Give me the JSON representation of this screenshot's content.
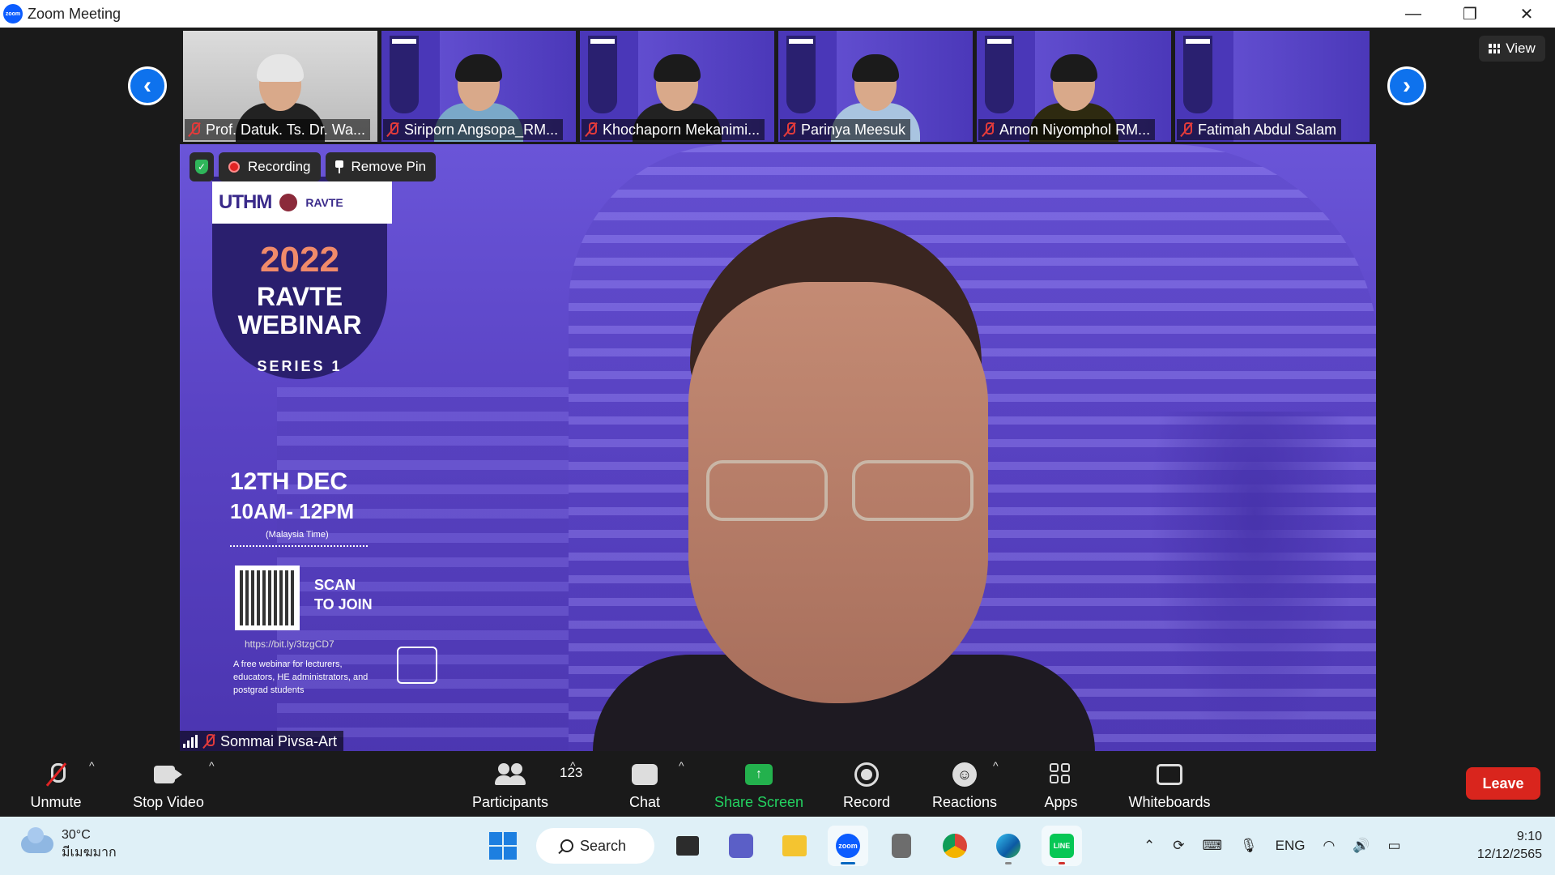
{
  "window": {
    "title": "Zoom Meeting",
    "logo_text": "zoom",
    "controls": {
      "minimize": "—",
      "restore": "❐",
      "close": "✕"
    }
  },
  "view_button": {
    "label": "View"
  },
  "nav": {
    "prev": "‹",
    "next": "›"
  },
  "participants_strip": [
    {
      "name": "Prof. Datuk. Ts. Dr. Wa...",
      "bg": "gray",
      "hair": "white"
    },
    {
      "name": "Siriporn Angsopa_RM...",
      "bg": "purple",
      "hair": "dark"
    },
    {
      "name": "Khochaporn Mekanimi...",
      "bg": "purple",
      "hair": "dark"
    },
    {
      "name": "Parinya Meesuk",
      "bg": "purple",
      "hair": "dark"
    },
    {
      "name": "Arnon Niyomphol RM...",
      "bg": "purple",
      "hair": "dark"
    },
    {
      "name": "Fatimah Abdul Salam",
      "bg": "purple",
      "hair": "none"
    }
  ],
  "main_video": {
    "recording_label": "Recording",
    "remove_pin_label": "Remove Pin",
    "speaker_name": "Sommai Pivsa-Art",
    "poster": {
      "uthm": "UTHM",
      "ravte": "RAVTE",
      "year": "2022",
      "title_line1": "RAVTE",
      "title_line2": "WEBINAR",
      "series": "SERIES 1",
      "date": "12TH DEC",
      "time": "10AM- 12PM",
      "timezone": "(Malaysia Time)",
      "scan_line1": "SCAN",
      "scan_line2": "TO JOIN",
      "url": "https://bit.ly/3tzgCD7",
      "description": "A free webinar for lecturers, educators, HE administrators, and postgrad students"
    }
  },
  "controls": {
    "unmute": "Unmute",
    "stop_video": "Stop Video",
    "participants": "Participants",
    "participant_count": "123",
    "chat": "Chat",
    "share_screen": "Share Screen",
    "record": "Record",
    "reactions": "Reactions",
    "apps": "Apps",
    "whiteboards": "Whiteboards",
    "leave": "Leave",
    "caret": "^"
  },
  "taskbar": {
    "weather_temp": "30°C",
    "weather_desc": "มีเมฆมาก",
    "search_label": "Search",
    "lang": "ENG",
    "time": "9:10",
    "date": "12/12/2565",
    "zoom_label": "zoom",
    "line_label": "LINE"
  },
  "colors": {
    "zoom_blue": "#0e72ed",
    "share_green": "#23b14d",
    "leave_red": "#d9251d",
    "stage_bg": "#1a1a1a",
    "taskbar_bg": "#dff0f7"
  }
}
